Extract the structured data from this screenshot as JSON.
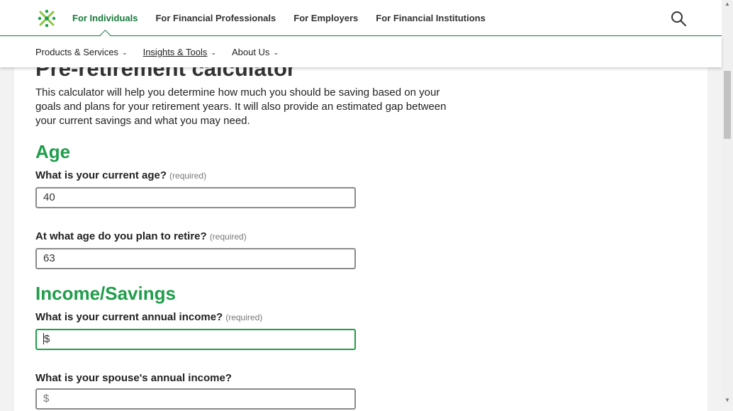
{
  "header": {
    "top_nav": [
      {
        "label": "For Individuals",
        "active": true
      },
      {
        "label": "For Financial Professionals",
        "active": false
      },
      {
        "label": "For Employers",
        "active": false
      },
      {
        "label": "For Financial Institutions",
        "active": false
      }
    ],
    "sub_nav": [
      {
        "label": "Products & Services"
      },
      {
        "label": "Insights & Tools"
      },
      {
        "label": "About Us"
      }
    ]
  },
  "page": {
    "title": "Pre-retirement calculator",
    "intro": "This calculator will help you determine how much you should be saving based on your goals and plans for your retirement years. It will also provide an estimated gap between your current savings and what you may need."
  },
  "sections": {
    "age": {
      "heading": "Age",
      "current_age_label": "What is your current age?",
      "current_age_required": "(required)",
      "current_age_value": "40",
      "retire_age_label": "At what age do you plan to retire?",
      "retire_age_required": "(required)",
      "retire_age_value": "63"
    },
    "income": {
      "heading": "Income/Savings",
      "annual_income_label": "What is your current annual income?",
      "annual_income_required": "(required)",
      "annual_income_value": "$",
      "spouse_income_label": "What is your spouse's annual income?",
      "spouse_income_value": "$"
    }
  },
  "colors": {
    "brand_green": "#1f9d4a",
    "dark_green": "#1a7a3c"
  },
  "icons": {
    "logo": "brand-logo-icon",
    "search": "search-icon",
    "chevron": "chevron-down-icon"
  }
}
